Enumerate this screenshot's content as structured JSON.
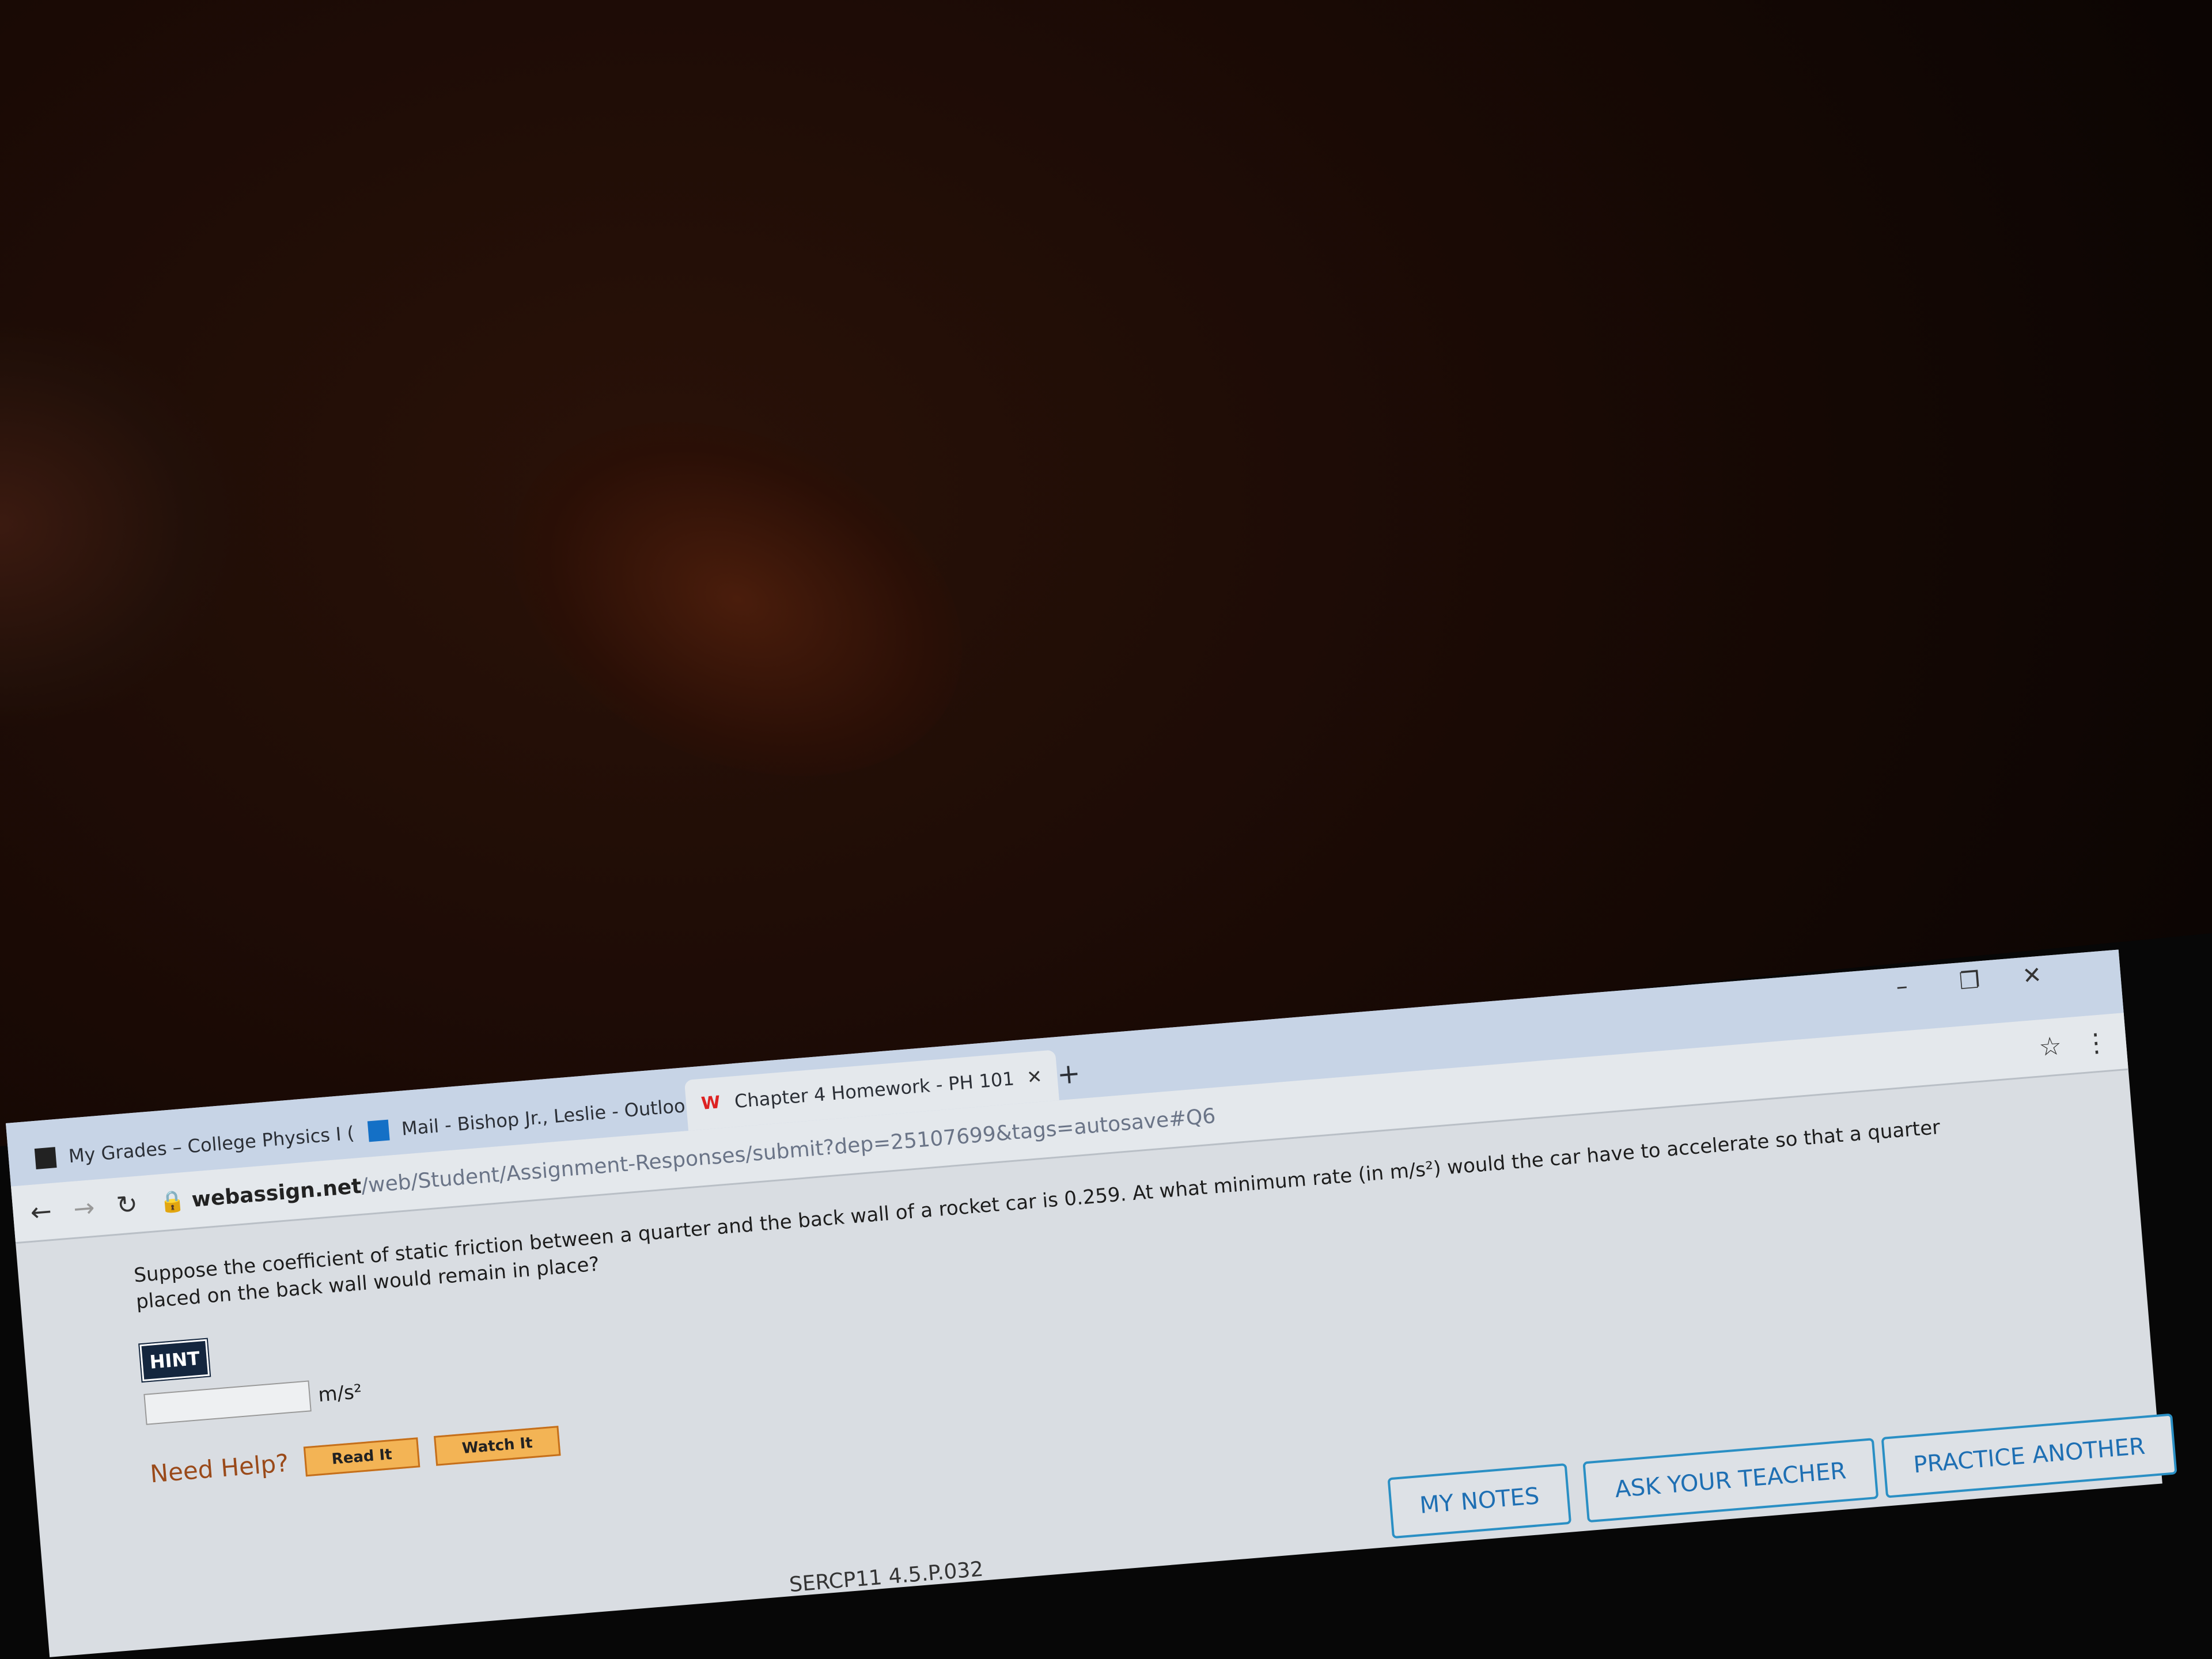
{
  "browser": {
    "tabs": [
      {
        "label": "My Grades – College Physics I (",
        "icon": "blackboard-icon"
      },
      {
        "label": "Mail - Bishop Jr., Leslie - Outlook",
        "icon": "outlook-icon"
      },
      {
        "label": "Chapter 4 Homework - PH 101",
        "icon": "webassign-icon",
        "active": true
      }
    ],
    "new_tab": "+",
    "url_host": "webassign.net",
    "url_path": "/web/Student/Assignment-Responses/submit?dep=25107699&tags=autosave#Q6"
  },
  "question": {
    "text": "Suppose the coefficient of static friction between a quarter and the back wall of a rocket car is 0.259. At what minimum rate (in m/s²) would the car have to accelerate so that a quarter placed on the back wall would remain in place?",
    "hint_label": "HINT",
    "answer_value": "",
    "unit": "m/s²",
    "need_help": "Need Help?",
    "read_it": "Read It",
    "watch_it": "Watch It"
  },
  "actions": {
    "my_notes": "MY NOTES",
    "ask_teacher": "ASK YOUR TEACHER",
    "practice_another": "PRACTICE ANOTHER"
  },
  "footer_partial": "SERCP11 4.5.P.032",
  "colors": {
    "accent": "#2a8fc4",
    "hint_bg": "#14263e",
    "help_button": "#f3b455"
  }
}
